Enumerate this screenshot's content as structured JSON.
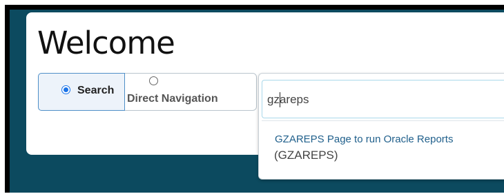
{
  "page": {
    "title": "Welcome"
  },
  "mode": {
    "options": [
      {
        "label": "Search",
        "selected": true
      },
      {
        "label": "Direct Navigation",
        "selected": false
      }
    ]
  },
  "search": {
    "value": "gzareps"
  },
  "results": [
    {
      "title": "GZAREPS Page to run Oracle Reports",
      "code": "(GZAREPS)"
    }
  ],
  "colors": {
    "background": "#0c4a5f",
    "accent": "#1a73e8",
    "link": "#1f5f8b"
  }
}
